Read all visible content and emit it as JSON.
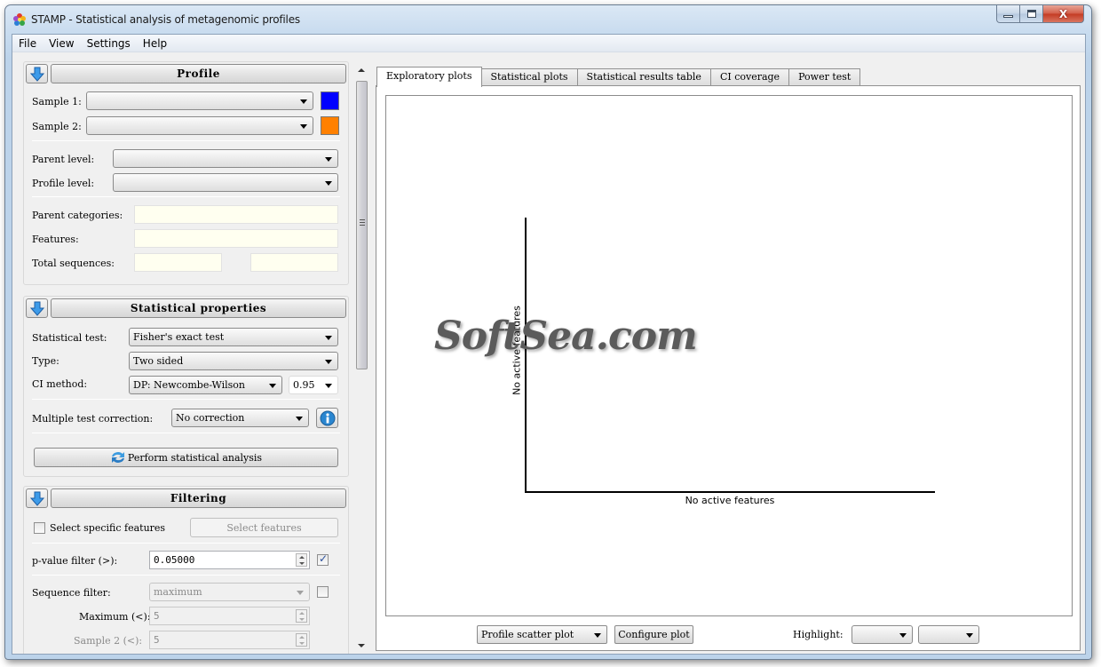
{
  "window": {
    "title": "STAMP - Statistical analysis of metagenomic profiles",
    "close_glyph": "X"
  },
  "menu": [
    "File",
    "View",
    "Settings",
    "Help"
  ],
  "profile": {
    "header": "Profile",
    "sample1_label": "Sample 1:",
    "sample1_value": "",
    "sample1_color": "#0000ff",
    "sample2_label": "Sample 2:",
    "sample2_value": "",
    "sample2_color": "#ff8000",
    "parent_level_label": "Parent level:",
    "parent_level_value": "",
    "profile_level_label": "Profile level:",
    "profile_level_value": "",
    "parent_categories_label": "Parent categories:",
    "parent_categories_value": "",
    "features_label": "Features:",
    "features_value": "",
    "total_sequences_label": "Total sequences:",
    "total_sequences_1": "",
    "total_sequences_2": ""
  },
  "statistical_properties": {
    "header": "Statistical properties",
    "test_label": "Statistical test:",
    "test_value": "Fisher's exact test",
    "type_label": "Type:",
    "type_value": "Two sided",
    "ci_label": "CI method:",
    "ci_value": "DP: Newcombe-Wilson",
    "ci_level": "0.95",
    "correction_label": "Multiple test correction:",
    "correction_value": "No correction",
    "perform_button": "Perform statistical analysis"
  },
  "filtering": {
    "header": "Filtering",
    "select_specific_label": "Select specific features",
    "select_specific_checked": false,
    "select_features_button": "Select features",
    "pvalue_label": "p-value filter (>):",
    "pvalue_value": "0.05000",
    "pvalue_enabled": true,
    "sequence_filter_label": "Sequence filter:",
    "sequence_filter_value": "maximum",
    "sequence_filter_enabled": false,
    "maximum_label": "Maximum (<):",
    "maximum_value": "5",
    "sample2_label": "Sample 2 (<):",
    "sample2_value": "5"
  },
  "tabs": [
    {
      "label": "Exploratory plots",
      "active": true
    },
    {
      "label": "Statistical plots",
      "active": false
    },
    {
      "label": "Statistical results table",
      "active": false
    },
    {
      "label": "CI coverage",
      "active": false
    },
    {
      "label": "Power test",
      "active": false
    }
  ],
  "plot": {
    "xlabel": "No active features",
    "ylabel": "No active features",
    "watermark": "SoftSea.com"
  },
  "bottom": {
    "plot_type": "Profile scatter plot",
    "configure_button": "Configure plot",
    "highlight_label": "Highlight:",
    "highlight_1": "",
    "highlight_2": ""
  }
}
